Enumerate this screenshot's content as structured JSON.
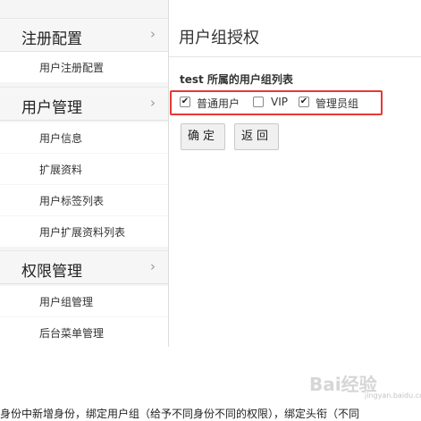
{
  "sidebar": {
    "sections": [
      {
        "title": "注册配置",
        "items": [
          "用户注册配置"
        ]
      },
      {
        "title": "用户管理",
        "items": [
          "用户信息",
          "扩展资料",
          "用户标签列表",
          "用户扩展资料列表"
        ]
      },
      {
        "title": "权限管理",
        "items": [
          "用户组管理",
          "后台菜单管理"
        ]
      }
    ]
  },
  "main": {
    "title": "用户组授权",
    "group_heading": "test 所属的用户组列表",
    "checkboxes": [
      {
        "label": "普通用户",
        "checked": true
      },
      {
        "label": "VIP",
        "checked": false
      },
      {
        "label": "管理员组",
        "checked": true
      }
    ],
    "buttons": {
      "confirm": "确定",
      "back": "返回"
    }
  },
  "caption": "身份中新增身份，绑定用户组（给予不同身份不同的权限），绑定头衔（不同",
  "watermark": {
    "text": "Bai经验",
    "sub": "jingyan.baidu.com"
  },
  "colors": {
    "highlight_box": "#e53935",
    "sidebar_bg": "#f5f5f5"
  },
  "icons": {
    "section_chevron": "chevron-right-icon",
    "check": "checkmark-icon"
  }
}
